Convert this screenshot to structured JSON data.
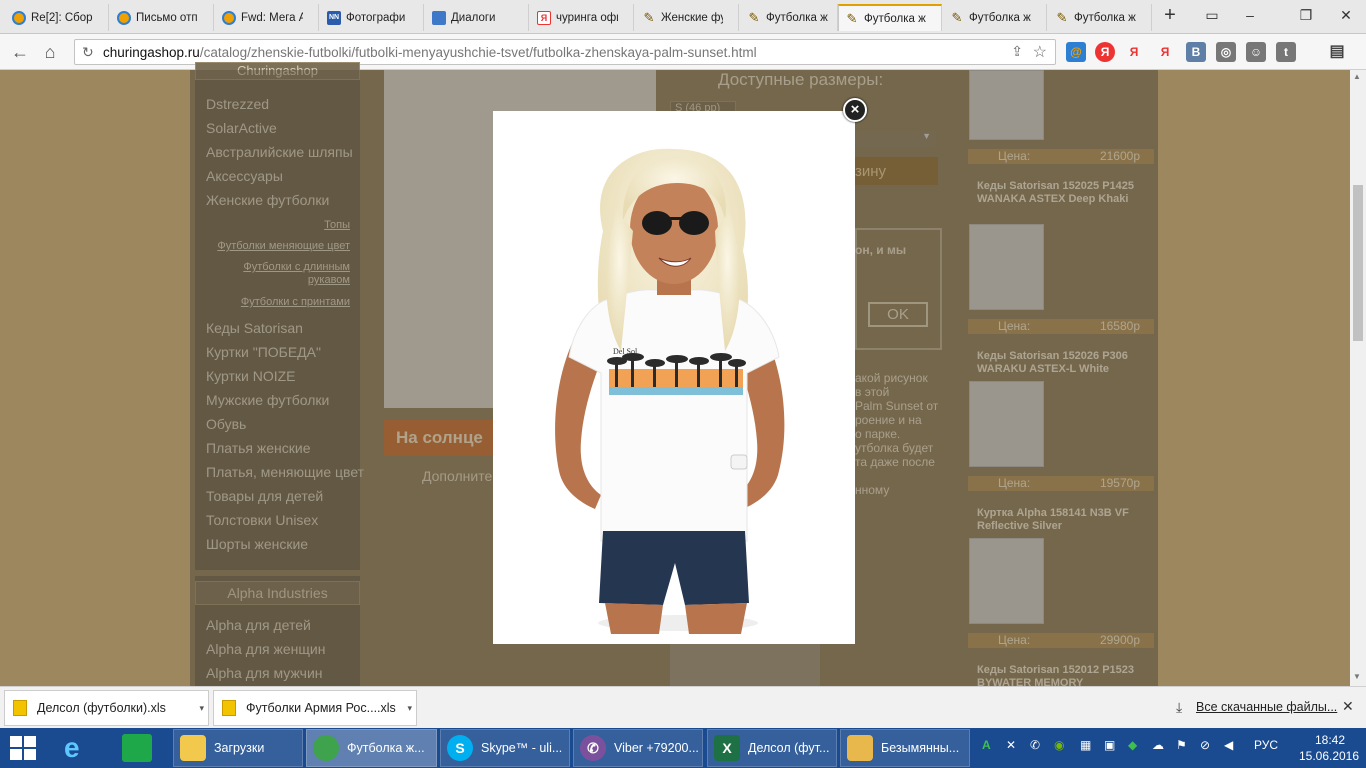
{
  "tabs": [
    {
      "label": "Re[2]: Сбор",
      "icon": "mail-icon"
    },
    {
      "label": "Письмо отп",
      "icon": "mail-icon"
    },
    {
      "label": "Fwd: Мега А",
      "icon": "mail-icon"
    },
    {
      "label": "Фотографи",
      "icon": "nn-icon"
    },
    {
      "label": "Диалоги",
      "icon": "dialog-icon"
    },
    {
      "label": "чуринга офи",
      "icon": "yandex-icon"
    },
    {
      "label": "Женские фу",
      "icon": "shop-icon"
    },
    {
      "label": "Футболка ж",
      "icon": "shop-icon"
    },
    {
      "label": "Футболка ж",
      "icon": "shop-icon",
      "active": true
    },
    {
      "label": "Футболка ж",
      "icon": "shop-icon"
    },
    {
      "label": "Футболка ж",
      "icon": "shop-icon"
    }
  ],
  "address": {
    "domain": "churingashop.ru",
    "path": "/catalog/zhenskie-futbolki/futbolki-menyayushchie-tsvet/futbolka-zhenskaya-palm-sunset.html"
  },
  "sidebar": {
    "header_top": "Churingashop",
    "items": [
      "Dstrezzed",
      "SolarActive",
      "Австралийские шляпы",
      "Аксессуары",
      "Женские футболки"
    ],
    "subitems": [
      "Топы",
      "Футболки меняющие цвет",
      "Футболки с длинным рукавом",
      "Футболки с принтами"
    ],
    "items2": [
      "Кеды Satorisan",
      "Куртки \"ПОБЕДА\"",
      "Куртки NOIZE",
      "Мужские футболки",
      "Обувь",
      "Платья женские",
      "Платья, меняющие цвет",
      "Товары для детей",
      "Толстовки Unisex",
      "Шорты женские"
    ],
    "section2_header": "Alpha Industries",
    "section2_items": [
      "Alpha для детей",
      "Alpha для женщин",
      "Alpha для мужчин"
    ]
  },
  "main": {
    "sizes_label": "Доступные размеры:",
    "size_value": "S (46 рр)",
    "cart_label": "зину",
    "phone_text": "он, и мы",
    "ok_label": "OK",
    "product_title": "На солнце",
    "more_label": "Дополните",
    "desc_lines": [
      "акой рисунок",
      "в этой",
      "Palm Sunset от",
      "роение и на",
      "о парке.",
      "утболка будет",
      "та даже после",
      "нному"
    ]
  },
  "products": [
    {
      "price_label": "Цена:",
      "price": "21600р"
    },
    {
      "name": "Кеды Satorisan 152025 P1425 WANAKA ASTEX Deep Khaki",
      "price_label": "Цена:",
      "price": "16580р"
    },
    {
      "name": "Кеды Satorisan 152026 P306 WARAKU ASTEX-L White",
      "price_label": "Цена:",
      "price": "19570р"
    },
    {
      "name": "Куртка Alpha 158141 N3B VF Reflective Silver",
      "price_label": "Цена:",
      "price": "29900р"
    },
    {
      "name": "Кеды Satorisan 152012 P1523 BYWATER MEMORY"
    }
  ],
  "modal": {
    "shirt_brand": "Del Sol",
    "close_glyph": "×"
  },
  "downloads": {
    "items": [
      "Делсол (футболки).xls",
      "Футболки Армия Рос....xls"
    ],
    "all_label": "Все скачанные файлы..."
  },
  "taskbar": {
    "buttons": [
      {
        "label": "Загрузки"
      },
      {
        "label": "Футболка ж..."
      },
      {
        "label": "Skype™ - uli..."
      },
      {
        "label": "Viber +79200..."
      },
      {
        "label": "Делсол (фут..."
      },
      {
        "label": "Безымянны..."
      }
    ],
    "lang": "РУС",
    "time": "18:42",
    "date": "15.06.2016"
  },
  "colors": {
    "page_bg": "#c9a96e",
    "center_bg": "#8a7a5a",
    "price_bar": "#b08f56",
    "taskbar": "#1a4a8f",
    "active_tab_accent": "#e0a000"
  }
}
